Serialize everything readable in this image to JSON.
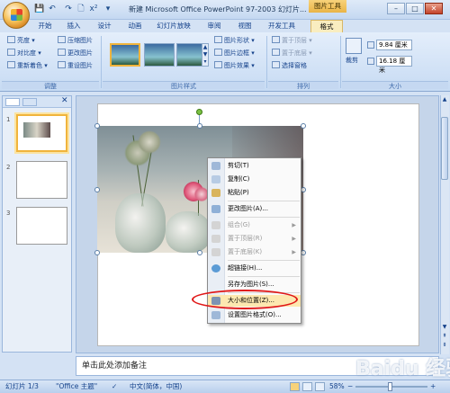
{
  "window": {
    "title": "新建 Microsoft Office PowerPoint 97-2003 幻灯片...",
    "context_group": "图片工具",
    "min_label": "–",
    "max_label": "□",
    "close_label": "✕"
  },
  "quick_access": {
    "save": "💾",
    "undo": "↶",
    "redo": "↷",
    "print": "🗋",
    "format": "x²",
    "more": "▾"
  },
  "tabs": [
    "开始",
    "插入",
    "设计",
    "动画",
    "幻灯片放映",
    "审阅",
    "视图",
    "开发工具",
    "格式"
  ],
  "active_tab": "格式",
  "ribbon": {
    "adjust": {
      "items": [
        "亮度 ▾",
        "对比度 ▾",
        "重新着色 ▾"
      ],
      "items2": [
        "压缩图片",
        "更改图片",
        "重设图片"
      ],
      "label": "调整"
    },
    "styles": {
      "label": "图片样式",
      "items": [
        "图片形状 ▾",
        "图片边框 ▾",
        "图片效果 ▾"
      ]
    },
    "arrange": {
      "label": "排列",
      "items": [
        "置于顶层 ▾",
        "置于底层 ▾",
        "选择窗格"
      ]
    },
    "size": {
      "label": "大小",
      "crop": "裁剪",
      "height": "9.84 厘米",
      "width": "16.18 厘米"
    }
  },
  "slides": [
    {
      "num": "1"
    },
    {
      "num": "2"
    },
    {
      "num": "3"
    }
  ],
  "context_menu": {
    "items": [
      {
        "label": "剪切(T)",
        "icon": "cut-icon",
        "disabled": false
      },
      {
        "label": "复制(C)",
        "icon": "copy-icon",
        "disabled": false
      },
      {
        "label": "粘贴(P)",
        "icon": "paste-icon",
        "disabled": false
      },
      {
        "label": "更改图片(A)...",
        "icon": "change-picture-icon",
        "disabled": false
      },
      {
        "label": "组合(G)",
        "icon": "group-icon",
        "disabled": true
      },
      {
        "label": "置于顶层(R)",
        "icon": "bring-front-icon",
        "disabled": true
      },
      {
        "label": "置于底层(K)",
        "icon": "send-back-icon",
        "disabled": true
      },
      {
        "label": "超链接(H)...",
        "icon": "hyperlink-icon",
        "disabled": false
      },
      {
        "label": "另存为图片(S)...",
        "icon": "save-as-picture-icon",
        "disabled": false
      },
      {
        "label": "大小和位置(Z)...",
        "icon": "size-position-icon",
        "disabled": false
      },
      {
        "label": "设置图片格式(O)...",
        "icon": "format-picture-icon",
        "disabled": false
      }
    ]
  },
  "notes_placeholder": "单击此处添加备注",
  "statusbar": {
    "slide": "幻灯片 1/3",
    "theme": "\"Office 主题\"",
    "lang": "中文(简体，中国)",
    "zoom": "58%"
  },
  "watermark": "Baidu 经验",
  "colors": {
    "accent": "#f0b43c",
    "highlight_ellipse": "#e01818",
    "ribbon": "#c7dbf3"
  }
}
